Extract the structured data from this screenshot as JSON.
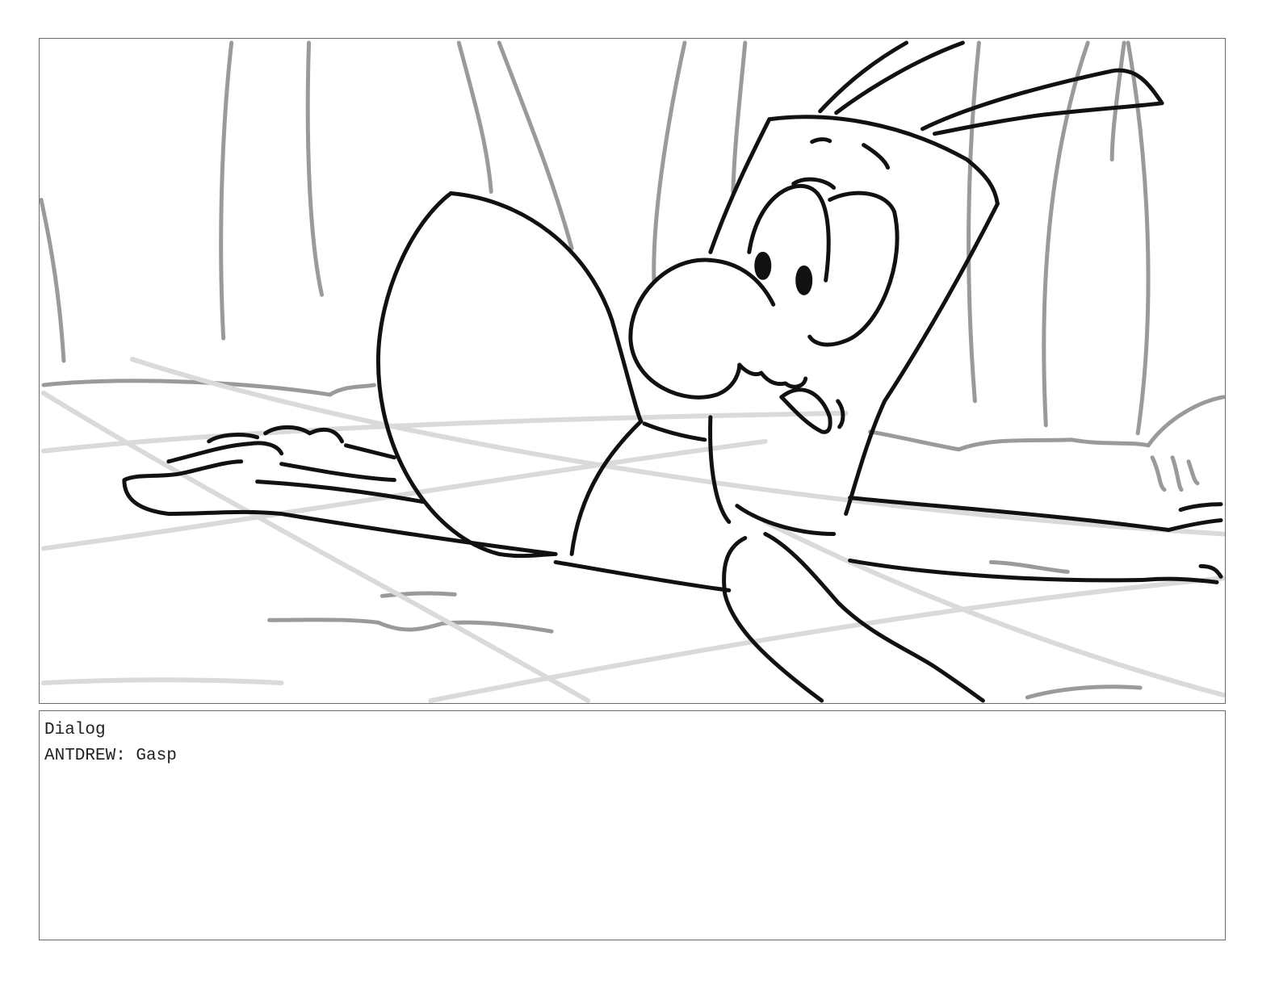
{
  "panel": {
    "description_icon": "storyboard-sketch"
  },
  "dialog": {
    "heading": "Dialog",
    "line": "ANTDREW: Gasp"
  }
}
